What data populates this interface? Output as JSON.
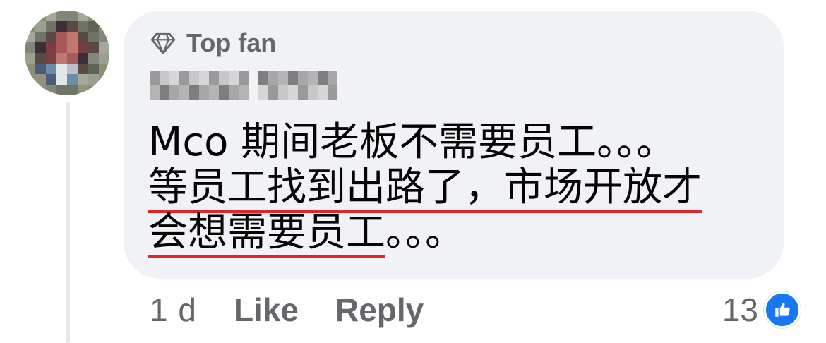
{
  "badge": {
    "icon": "diamond-icon",
    "label": "Top fan"
  },
  "comment": {
    "lines": [
      "Mco 期间老板不需要员工。。。",
      "等员工找到出路了，市场开放才",
      "会想需要员工",
      "。。。"
    ]
  },
  "actions": {
    "age": "1 d",
    "like_label": "Like",
    "reply_label": "Reply"
  },
  "reactions": {
    "count": "13",
    "icon": "thumbs-up-icon"
  },
  "colors": {
    "bubble": "#f0f2f5",
    "secondary_text": "#65676b",
    "underline": "#e0242b",
    "like_blue": "#1877f2"
  }
}
